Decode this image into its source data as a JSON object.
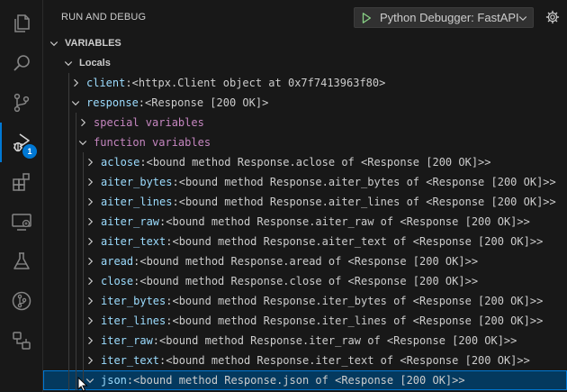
{
  "activity": {
    "badge": "1",
    "items": [
      {
        "name": "explorer-icon"
      },
      {
        "name": "search-icon"
      },
      {
        "name": "source-control-icon"
      },
      {
        "name": "run-debug-icon",
        "active": true
      },
      {
        "name": "extensions-icon"
      },
      {
        "name": "remote-explorer-icon"
      },
      {
        "name": "testing-icon"
      },
      {
        "name": "git-graph-icon"
      },
      {
        "name": "containers-icon"
      }
    ]
  },
  "header": {
    "title": "RUN AND DEBUG",
    "config": "Python Debugger: FastAPI"
  },
  "variables": {
    "section_title": "VARIABLES",
    "rows": [
      {
        "depth": 1,
        "expanded": true,
        "kind": "scope",
        "name": "Locals"
      },
      {
        "depth": 2,
        "expanded": false,
        "name": "client",
        "value": "<httpx.Client object at 0x7f7413963f80>"
      },
      {
        "depth": 2,
        "expanded": true,
        "name": "response",
        "value": "<Response [200 OK]>"
      },
      {
        "depth": 3,
        "expanded": false,
        "kind": "group",
        "name": "special variables"
      },
      {
        "depth": 3,
        "expanded": true,
        "kind": "group",
        "name": "function variables"
      },
      {
        "depth": 4,
        "expanded": false,
        "name": "aclose",
        "value": "<bound method Response.aclose of <Response [200 OK]>>"
      },
      {
        "depth": 4,
        "expanded": false,
        "name": "aiter_bytes",
        "value": "<bound method Response.aiter_bytes of <Response [200 OK]>>"
      },
      {
        "depth": 4,
        "expanded": false,
        "name": "aiter_lines",
        "value": "<bound method Response.aiter_lines of <Response [200 OK]>>"
      },
      {
        "depth": 4,
        "expanded": false,
        "name": "aiter_raw",
        "value": "<bound method Response.aiter_raw of <Response [200 OK]>>"
      },
      {
        "depth": 4,
        "expanded": false,
        "name": "aiter_text",
        "value": "<bound method Response.aiter_text of <Response [200 OK]>>"
      },
      {
        "depth": 4,
        "expanded": false,
        "name": "aread",
        "value": "<bound method Response.aread of <Response [200 OK]>>"
      },
      {
        "depth": 4,
        "expanded": false,
        "name": "close",
        "value": "<bound method Response.close of <Response [200 OK]>>"
      },
      {
        "depth": 4,
        "expanded": false,
        "name": "iter_bytes",
        "value": "<bound method Response.iter_bytes of <Response [200 OK]>>"
      },
      {
        "depth": 4,
        "expanded": false,
        "name": "iter_lines",
        "value": "<bound method Response.iter_lines of <Response [200 OK]>>"
      },
      {
        "depth": 4,
        "expanded": false,
        "name": "iter_raw",
        "value": "<bound method Response.iter_raw of <Response [200 OK]>>"
      },
      {
        "depth": 4,
        "expanded": false,
        "name": "iter_text",
        "value": "<bound method Response.iter_text of <Response [200 OK]>>"
      },
      {
        "depth": 4,
        "expanded": true,
        "selected": true,
        "name": "json",
        "value": "<bound method Response.json of <Response [200 OK]>>"
      }
    ]
  }
}
